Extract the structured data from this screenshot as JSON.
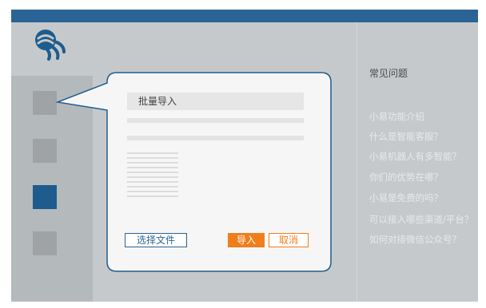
{
  "colors": {
    "brand_blue": "#2a6496",
    "accent_orange": "#f07e1b",
    "background_gray": "#c6c9cb",
    "sidebar_gray": "#b4b9bc"
  },
  "logo": {
    "icon": "brand-logo-icon"
  },
  "sidebar": {
    "items": [
      {
        "icon": "nav-tile-1",
        "active": false
      },
      {
        "icon": "nav-tile-2",
        "active": false
      },
      {
        "icon": "nav-tile-3",
        "active": true
      },
      {
        "icon": "nav-tile-4",
        "active": false
      }
    ]
  },
  "dialog": {
    "filename_placeholder": "批量导入",
    "select_file_label": "选择文件",
    "import_label": "导入",
    "cancel_label": "取消"
  },
  "faq": {
    "title": "常见问题",
    "items": [
      "小易功能介绍",
      "什么是智能客服？",
      "小易机器人有多智能？",
      "你们的优势在哪？",
      "小易是免费的吗？",
      "可以接入哪些渠道/平台？",
      "如何对接微信公众号？"
    ]
  }
}
